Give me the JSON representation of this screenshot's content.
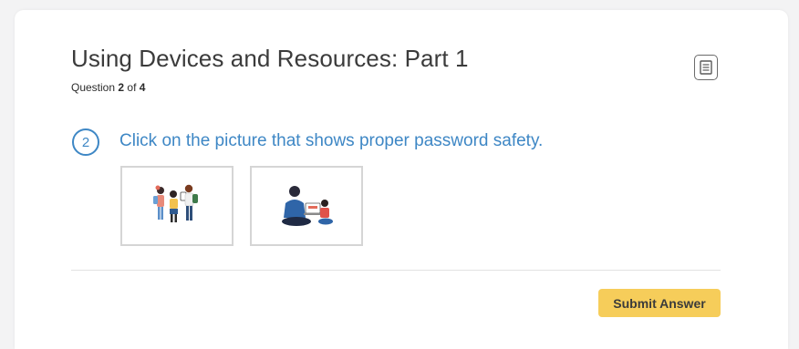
{
  "lesson": {
    "title": "Using Devices and Resources: Part 1",
    "question_prefix": "Question ",
    "question_current": "2",
    "question_of": " of ",
    "question_total": "4"
  },
  "question": {
    "number": "2",
    "prompt": "Click on the picture that shows proper password safety."
  },
  "choices": [
    {
      "image": "children-sharing-phone"
    },
    {
      "image": "adult-and-child-at-laptop"
    }
  ],
  "actions": {
    "submit_label": "Submit Answer",
    "notes_icon": "notes-icon"
  },
  "colors": {
    "accent_blue": "#3e87c5",
    "submit_yellow": "#f6cd5a",
    "title_text": "#3b3b3b"
  }
}
